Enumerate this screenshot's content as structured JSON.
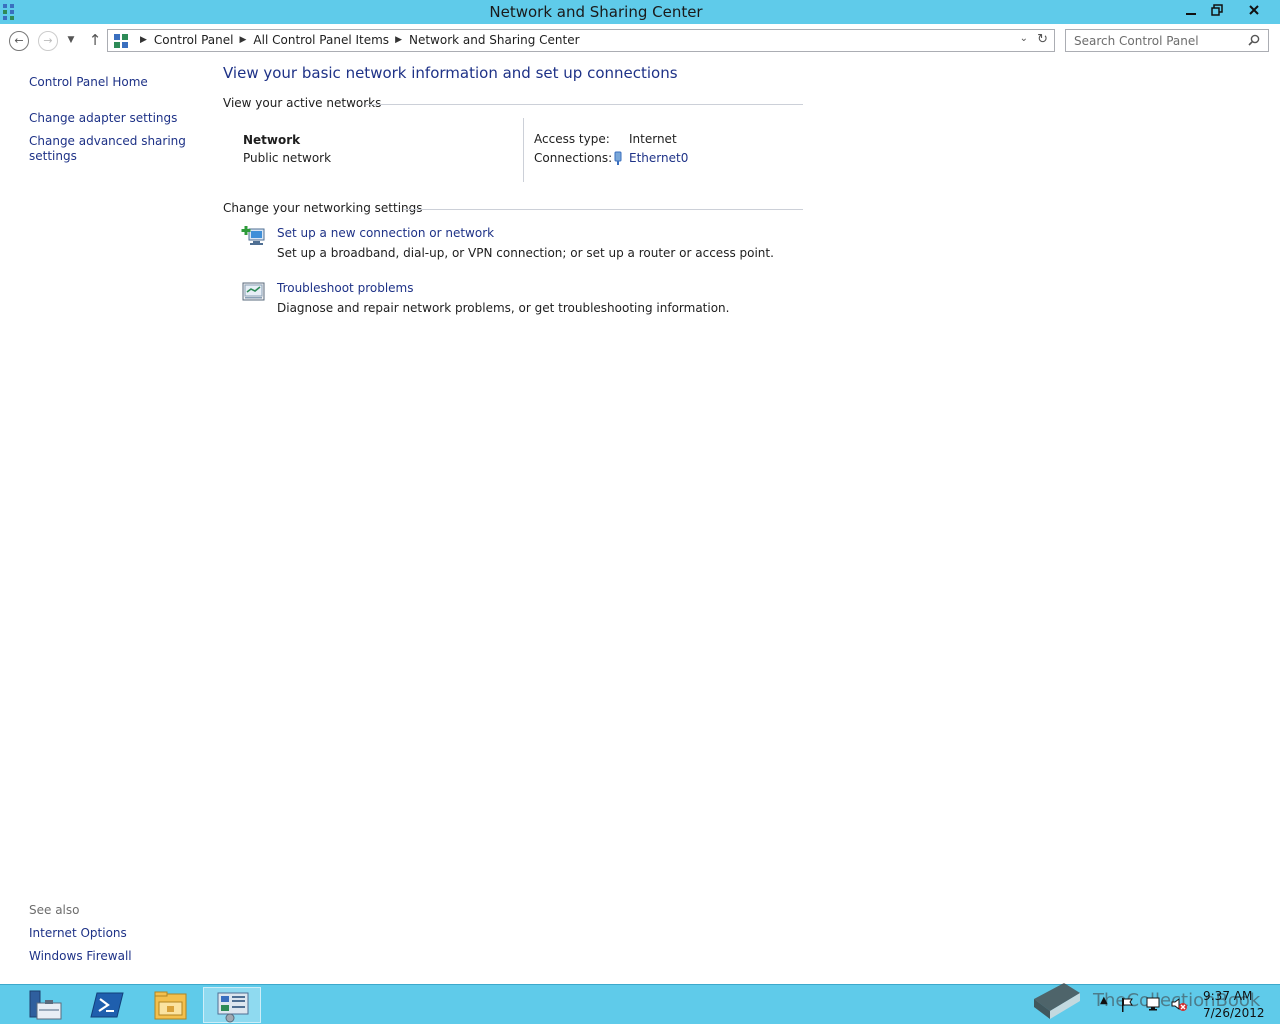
{
  "window": {
    "title": "Network and Sharing Center"
  },
  "toolbar": {
    "breadcrumbs": [
      "Control Panel",
      "All Control Panel Items",
      "Network and Sharing Center"
    ],
    "search_placeholder": "Search Control Panel"
  },
  "sidebar": {
    "items": [
      "Control Panel Home",
      "Change adapter settings",
      "Change advanced sharing settings"
    ],
    "see_also_label": "See also",
    "see_also": [
      "Internet Options",
      "Windows Firewall"
    ]
  },
  "main": {
    "title": "View your basic network information and set up connections",
    "active_networks_heading": "View your active networks",
    "network_name": "Network",
    "network_type": "Public network",
    "access_type_label": "Access type:",
    "access_type_value": "Internet",
    "connections_label": "Connections:",
    "connections_value": "Ethernet0",
    "change_settings_heading": "Change your networking settings",
    "tasks": [
      {
        "link": "Set up a new connection or network",
        "desc": "Set up a broadband, dial-up, or VPN connection; or set up a router or access point.",
        "icon": "new-connection-icon"
      },
      {
        "link": "Troubleshoot problems",
        "desc": "Diagnose and repair network problems, or get troubleshooting information.",
        "icon": "troubleshoot-icon"
      }
    ]
  },
  "taskbar": {
    "apps": [
      "server-manager-icon",
      "powershell-icon",
      "file-explorer-icon",
      "control-panel-icon"
    ],
    "active_app": "control-panel-icon",
    "clock_time": "9:37 AM",
    "clock_date": "7/26/2012",
    "watermark": "TheCollectionBook"
  },
  "colors": {
    "titlebar": "#5fcbea",
    "link": "#1e3287",
    "taskbar": "#5fcbea"
  }
}
